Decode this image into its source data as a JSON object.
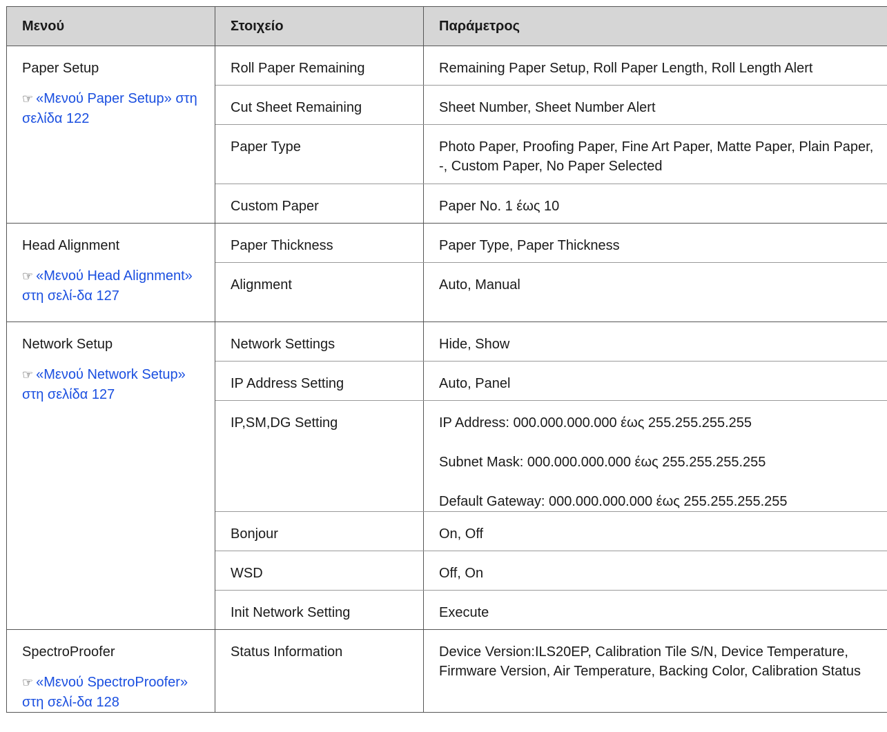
{
  "headers": {
    "menu": "Μενού",
    "item": "Στοιχείο",
    "param": "Παράμετρος"
  },
  "groups": [
    {
      "menu": "Paper Setup",
      "link": "«Μενού Paper Setup» στη σελίδα 122",
      "rows": [
        {
          "item": "Roll Paper Remaining",
          "params": [
            "Remaining Paper Setup, Roll Paper Length, Roll Length Alert"
          ]
        },
        {
          "item": "Cut Sheet Remaining",
          "params": [
            "Sheet Number, Sheet Number Alert"
          ]
        },
        {
          "item": "Paper Type",
          "params": [
            "Photo Paper, Proofing Paper, Fine Art Paper, Matte Paper, Plain Paper, -, Custom Paper, No Paper Selected"
          ]
        },
        {
          "item": "Custom Paper",
          "params": [
            "Paper No. 1 έως 10"
          ]
        }
      ]
    },
    {
      "menu": "Head Alignment",
      "link": "«Μενού Head Alignment» στη σελί-δα 127",
      "rows": [
        {
          "item": "Paper Thickness",
          "params": [
            "Paper Type, Paper Thickness"
          ]
        },
        {
          "item": "Alignment",
          "params": [
            "Auto, Manual"
          ]
        }
      ]
    },
    {
      "menu": "Network Setup",
      "link": "«Μενού Network Setup» στη σελίδα 127",
      "rows": [
        {
          "item": "Network Settings",
          "params": [
            "Hide, Show"
          ]
        },
        {
          "item": "IP Address Setting",
          "params": [
            "Auto, Panel"
          ]
        },
        {
          "item": "IP,SM,DG Setting",
          "params": [
            "IP Address: 000.000.000.000 έως 255.255.255.255",
            "Subnet Mask: 000.000.000.000 έως 255.255.255.255",
            "Default Gateway: 000.000.000.000 έως 255.255.255.255"
          ]
        },
        {
          "item": "Bonjour",
          "params": [
            "On, Off"
          ]
        },
        {
          "item": "WSD",
          "params": [
            "Off, On"
          ]
        },
        {
          "item": "Init Network Setting",
          "params": [
            "Execute"
          ]
        }
      ]
    },
    {
      "menu": "SpectroProofer",
      "link": "«Μενού SpectroProofer» στη σελί-δα 128",
      "rows": [
        {
          "item": "Status Information",
          "params": [
            "Device Version:ILS20EP, Calibration Tile S/N, Device Temperature, Firmware Version, Air Temperature, Backing Color, Calibration Status"
          ]
        }
      ]
    }
  ],
  "icons": {
    "link_icon": "pointing-hand-icon"
  }
}
